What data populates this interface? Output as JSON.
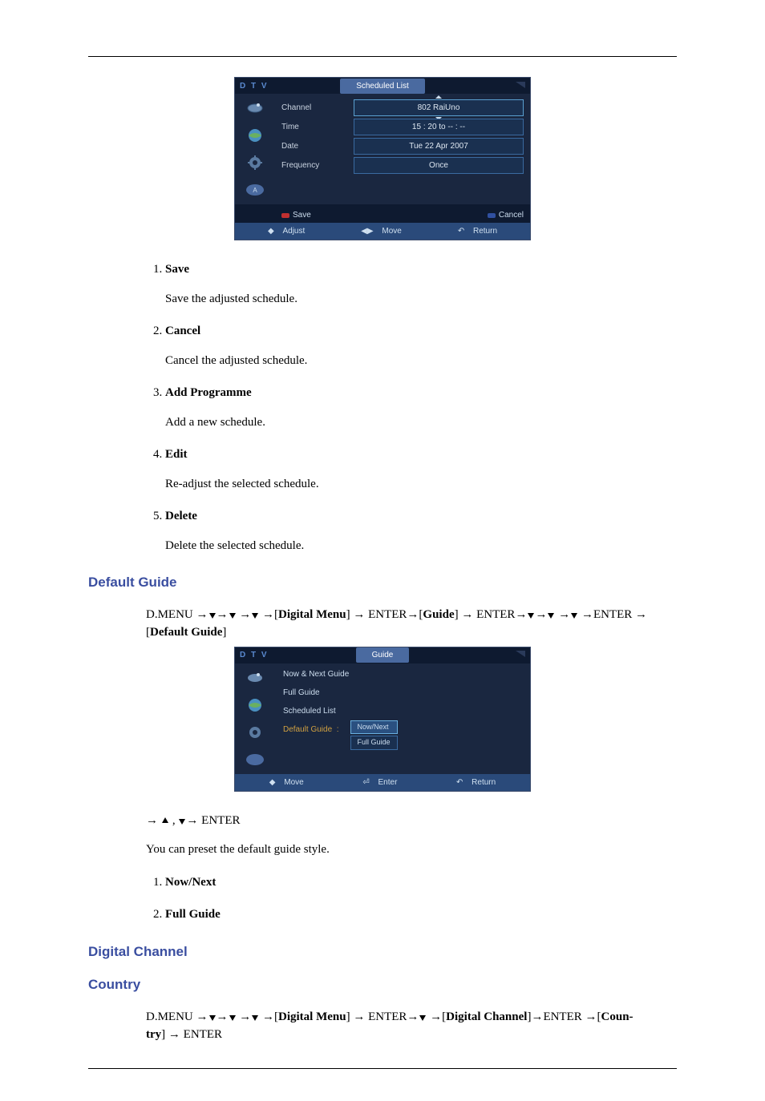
{
  "panel1": {
    "dtv": "D T V",
    "title": "Scheduled List",
    "rows": {
      "channel_label": "Channel",
      "channel_value": "802 RaiUno",
      "time_label": "Time",
      "time_value": "15 : 20 to -- : --",
      "date_label": "Date",
      "date_value": "Tue 22 Apr 2007",
      "freq_label": "Frequency",
      "freq_value": "Once"
    },
    "actions": {
      "save": "Save",
      "cancel": "Cancel"
    },
    "footer": {
      "adjust": "Adjust",
      "move": "Move",
      "return": "Return"
    }
  },
  "list1": {
    "items": [
      {
        "title": "Save",
        "desc": "Save the adjusted schedule."
      },
      {
        "title": "Cancel",
        "desc": "Cancel the adjusted schedule."
      },
      {
        "title": "Add Programme",
        "desc": "Add a new schedule."
      },
      {
        "title": "Edit",
        "desc": "Re-adjust the selected schedule."
      },
      {
        "title": "Delete",
        "desc": "Delete the selected schedule."
      }
    ]
  },
  "section_default_guide": "Default Guide",
  "nav1": {
    "prefix": "D.MENU ",
    "digital_menu": "Digital Menu",
    "enter": "ENTER",
    "guide": "Guide",
    "default_guide": "Default Guide"
  },
  "panel2": {
    "dtv": "D T V",
    "title": "Guide",
    "items": {
      "now_next": "Now & Next Guide",
      "full": "Full Guide",
      "scheduled": "Scheduled List",
      "default": "Default Guide"
    },
    "opts": {
      "now_next": "Now/Next",
      "full": "Full Guide"
    },
    "footer": {
      "move": "Move",
      "enter": "Enter",
      "return": "Return"
    }
  },
  "nav2_enter": " ENTER",
  "para_preset": "You can preset the default guide style.",
  "list2": {
    "items": [
      {
        "title": "Now/Next"
      },
      {
        "title": "Full Guide"
      }
    ]
  },
  "section_digital_channel": "Digital Channel",
  "section_country": "Country",
  "nav3": {
    "prefix": "D.MENU ",
    "digital_menu": "Digital Menu",
    "enter": "ENTER",
    "digital_channel": "Digital Channel",
    "country1": "Coun-",
    "country2": "try"
  },
  "glyphs": {
    "updown": "◆",
    "leftright": "◀▶",
    "return": "↶",
    "enter": "⏎"
  }
}
